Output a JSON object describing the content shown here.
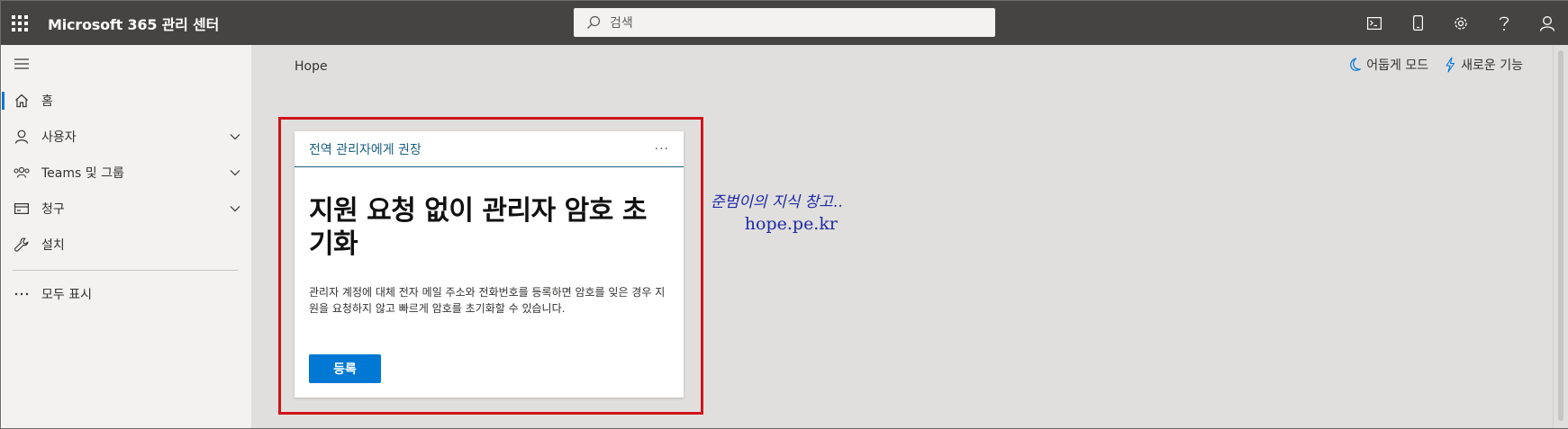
{
  "header": {
    "app_title": "Microsoft 365 관리 센터",
    "search_placeholder": "검색",
    "icons": [
      "waffle-icon",
      "search-icon",
      "terminal-icon",
      "mobile-icon",
      "settings-icon",
      "help-icon",
      "account-icon"
    ]
  },
  "sidebar": {
    "items": [
      {
        "label": "",
        "icon": "hamburger-icon"
      },
      {
        "label": "홈",
        "icon": "home-icon"
      },
      {
        "label": "사용자",
        "icon": "user-icon"
      },
      {
        "label": "Teams 및 그룹",
        "icon": "teams-groups-icon"
      },
      {
        "label": "청구",
        "icon": "billing-icon"
      },
      {
        "label": "설치",
        "icon": "wrench-icon"
      },
      {
        "label": "모두 표시",
        "icon": "more-icon"
      }
    ]
  },
  "main": {
    "breadcrumb": "Hope",
    "dark_mode_label": "어둡게 모드",
    "whats_new_label": "새로운 기능",
    "card": {
      "header": "전역 관리자에게 권장",
      "more": "···",
      "title": "지원 요청 없이 관리자 암호 초기화",
      "description": "관리자 계정에 대체 전자 메일 주소와 전화번호를 등록하면 암호를 잊은 경우 지원을 요청하지 않고 빠르게 암호를 초기화할 수 있습니다.",
      "button_label": "등록"
    },
    "watermark": {
      "line1": "준범이의 지식 창고..",
      "line2": "hope.pe.kr"
    }
  },
  "colors": {
    "topbar": "#464442",
    "sidebar": "#f3f2f1",
    "content_bg": "#e1dfdd",
    "accent": "#0078d4",
    "highlight": "#d0151b",
    "card_header_text": "#1a5f80"
  }
}
